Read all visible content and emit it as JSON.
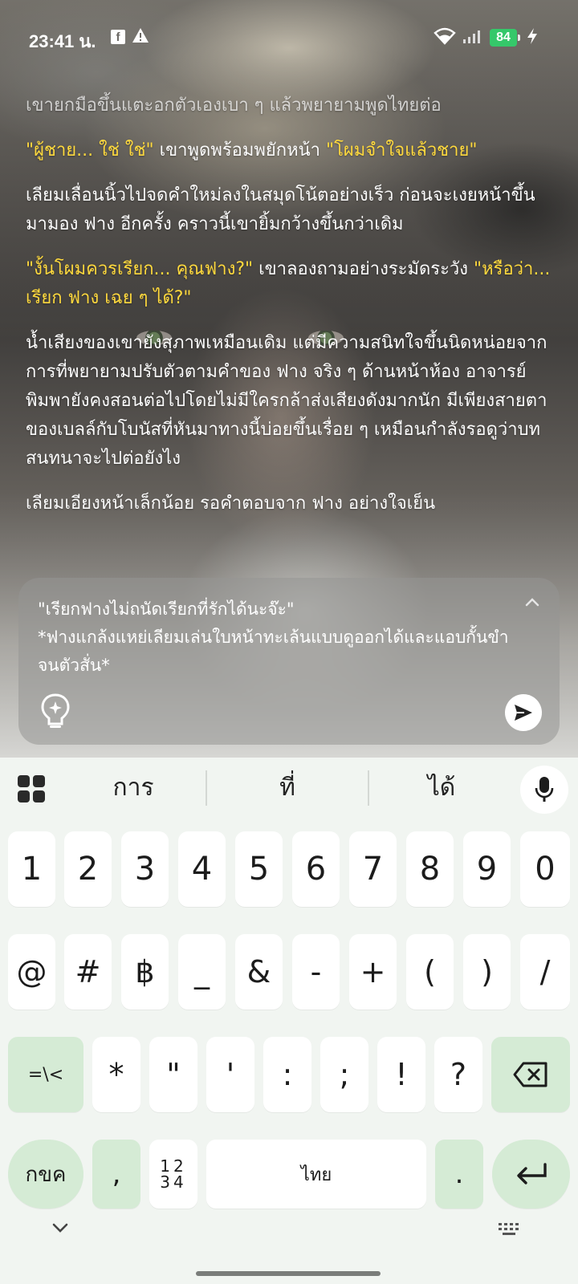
{
  "status_bar": {
    "time": "23:41 น.",
    "fb_glyph": "f",
    "battery": "84"
  },
  "story": {
    "p1": "เขายกมือขึ้นแตะอกตัวเองเบา ๆ แล้วพยายามพูดไทยต่อ",
    "p2_quote_a": "\"ผู้ชาย... ใช่ ใช่\"",
    "p2_mid": " เขาพูดพร้อมพยักหน้า ",
    "p2_quote_b": "\"โผมจำใจแล้วชาย\"",
    "p3": "เลียมเลื่อนนิ้วไปจดคำใหม่ลงในสมุดโน้ตอย่างเร็ว ก่อนจะเงยหน้าขึ้นมามอง ฟาง อีกครั้ง คราวนี้เขายิ้มกว้างขึ้นกว่าเดิม",
    "p4_quote_a": "\"งั้นโผมควรเรียก... คุณฟาง?\"",
    "p4_mid": " เขาลองถามอย่างระมัดระวัง ",
    "p4_quote_b": "\"หรือว่า... เรียก ฟาง เฉย ๆ ได้?\"",
    "p5": "น้ำเสียงของเขายังสุภาพเหมือนเดิม แต่มีความสนิทใจขึ้นนิดหน่อยจากการที่พยายามปรับตัวตามคำของ ฟาง จริง ๆ ด้านหน้าห้อง อาจารย์พิมพายังคงสอนต่อไปโดยไม่มีใครกล้าส่งเสียงดังมากนัก มีเพียงสายตาของเบลล์กับโบนัสที่หันมาทางนี้บ่อยขึ้นเรื่อย ๆ เหมือนกำลังรอดูว่าบทสนทนาจะไปต่อยังไง",
    "p6": "เลียมเอียงหน้าเล็กน้อย รอคำตอบจาก ฟาง อย่างใจเย็น"
  },
  "input": {
    "text": "\"เรียกฟางไม่ถนัดเรียกที่รักได้นะจ๊ะ\"\n*ฟางแกล้งแหย่เลียมเล่นใบหน้าทะเล้นแบบดูออกได้และแอบกั้นขำจนตัวสั่น*"
  },
  "keyboard": {
    "suggestions": [
      "การ",
      "ที่",
      "ได้"
    ],
    "row_numbers": [
      "1",
      "2",
      "3",
      "4",
      "5",
      "6",
      "7",
      "8",
      "9",
      "0"
    ],
    "row_symbols": [
      "@",
      "#",
      "฿",
      "_",
      "&",
      "-",
      "+",
      "(",
      ")",
      "/"
    ],
    "row_third": [
      "*",
      "\"",
      "'",
      ":",
      ";",
      "!",
      "?"
    ],
    "more_symbols_label": "=\\<",
    "lang_label": "กขค",
    "comma": ",",
    "numpad_top": "12",
    "numpad_bottom": "34",
    "space_label": "ไทย",
    "period": "."
  },
  "colors": {
    "quote_yellow": "#ffd93d",
    "quote_cyan": "#43e6da",
    "key_green": "#d5ebd5",
    "battery_green": "#35c86a"
  }
}
